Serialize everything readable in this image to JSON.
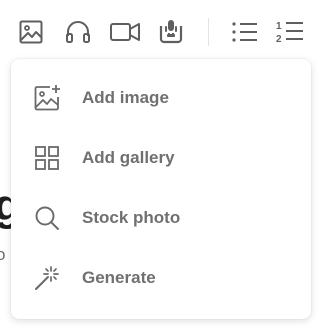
{
  "toolbar": {
    "buttons": [
      {
        "icon": "image-icon"
      },
      {
        "icon": "audio-icon"
      },
      {
        "icon": "video-icon"
      },
      {
        "icon": "podcast-icon"
      },
      {
        "icon": "bulleted-list-icon"
      },
      {
        "icon": "numbered-list-icon"
      }
    ],
    "numbered_list_digits": [
      "1",
      "2"
    ]
  },
  "background": {
    "heading_fragment": "g",
    "subtext_fragment": "o"
  },
  "menu": {
    "items": [
      {
        "label": "Add image",
        "icon": "add-image-icon"
      },
      {
        "label": "Add gallery",
        "icon": "gallery-grid-icon"
      },
      {
        "label": "Stock photo",
        "icon": "search-icon"
      },
      {
        "label": "Generate",
        "icon": "magic-wand-icon"
      }
    ]
  },
  "colors": {
    "icon": "#5f5f5f",
    "menu_text": "#707070",
    "separator": "#e3e3e3"
  }
}
